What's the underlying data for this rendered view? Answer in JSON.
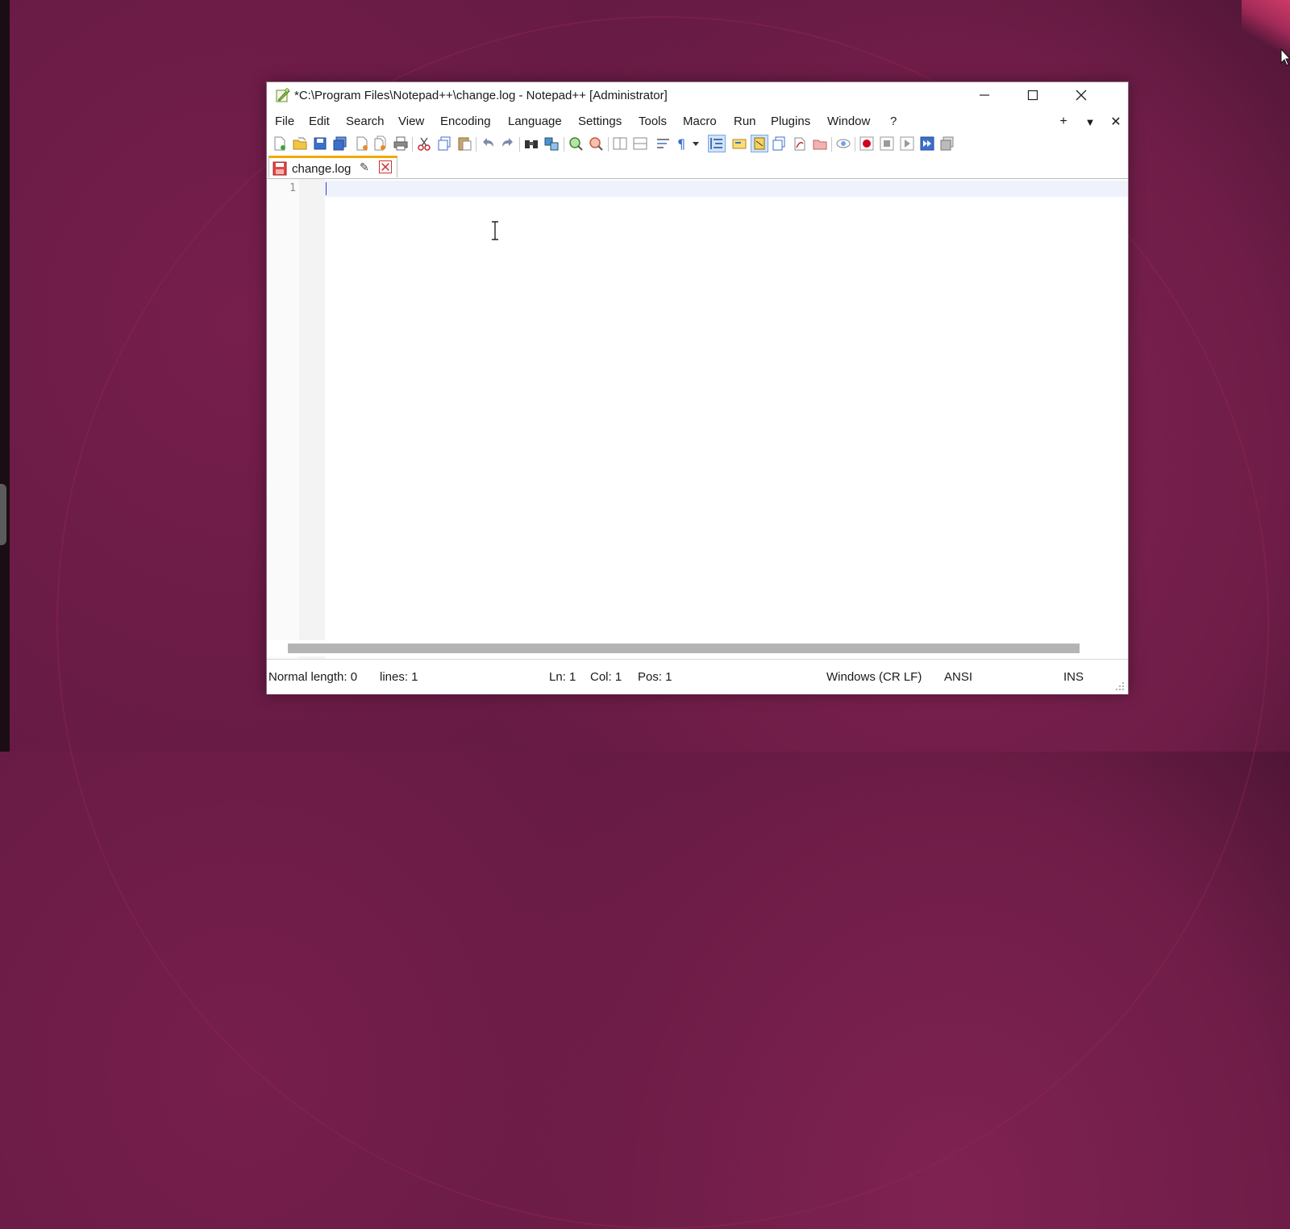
{
  "window": {
    "title": "*C:\\Program Files\\Notepad++\\change.log - Notepad++ [Administrator]"
  },
  "menu": {
    "items": [
      "File",
      "Edit",
      "Search",
      "View",
      "Encoding",
      "Language",
      "Settings",
      "Tools",
      "Macro",
      "Run",
      "Plugins",
      "Window",
      "?"
    ],
    "right_controls": [
      "+",
      "▼",
      "✕"
    ]
  },
  "toolbar": {
    "icons": [
      "new-file-icon",
      "open-file-icon",
      "save-icon",
      "save-all-icon",
      "close-icon",
      "close-all-icon",
      "print-icon",
      "cut-icon",
      "copy-icon",
      "paste-icon",
      "undo-icon",
      "redo-icon",
      "find-icon",
      "replace-icon",
      "zoom-in-icon",
      "zoom-out-icon",
      "sync-vertical-icon",
      "sync-horizontal-icon",
      "word-wrap-icon",
      "show-all-characters-icon",
      "dropdown-icon",
      "indent-guide-icon",
      "user-defined-language-icon",
      "document-map-icon",
      "function-list-icon",
      "folder-as-workspace-icon",
      "monitoring-icon",
      "start-recording-icon",
      "stop-recording-icon",
      "playback-icon",
      "run-macro-multiple-icon",
      "save-macro-icon"
    ]
  },
  "tabs": [
    {
      "label": "change.log",
      "pin_glyph": "📌"
    }
  ],
  "editor": {
    "line_numbers": [
      "1"
    ],
    "content": ""
  },
  "status": {
    "doc_type": "Normal length: 0",
    "lines": "lines: 1",
    "ln": "Ln: 1",
    "col": "Col: 1",
    "pos": "Pos: 1",
    "eol": "Windows (CR LF)",
    "encoding": "ANSI",
    "mode": "INS"
  },
  "colors": {
    "desktop": "#6f1d48",
    "tab_accent": "#f2a900",
    "current_line": "#eef2fb",
    "record_red": "#d0021b"
  }
}
